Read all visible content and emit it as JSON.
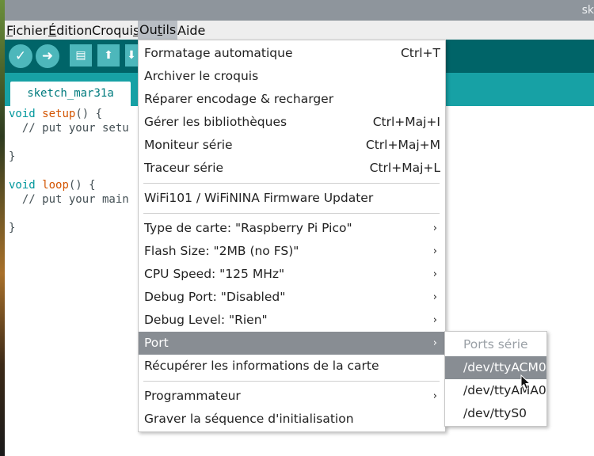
{
  "window": {
    "title": "sk"
  },
  "menubar": {
    "items": [
      {
        "label": "Fichier",
        "underline": "F"
      },
      {
        "label": "Édition",
        "underline": "É"
      },
      {
        "label": "Croquis",
        "underline": "s"
      },
      {
        "label": "Outils",
        "underline": "t"
      },
      {
        "label": "Aide",
        "underline": ""
      }
    ]
  },
  "toolbar": {
    "verify_icon": "checkmark-icon",
    "upload_icon": "arrow-right-icon",
    "new_icon": "file-icon",
    "open_icon": "arrow-up-icon",
    "save_icon": "arrow-down-icon"
  },
  "tabs": [
    {
      "label": "sketch_mar31a"
    }
  ],
  "editor": {
    "lines": [
      {
        "kw": "void",
        "fn": "setup",
        "rest": "() {"
      },
      {
        "text": "  // put your setu"
      },
      {
        "text": ""
      },
      {
        "text": "}"
      },
      {
        "text": ""
      },
      {
        "kw": "void",
        "fn": "loop",
        "rest": "() {"
      },
      {
        "text": "  // put your main"
      },
      {
        "text": ""
      },
      {
        "text": "}"
      }
    ]
  },
  "tools_menu": {
    "items": [
      {
        "label": "Formatage automatique",
        "shortcut": "Ctrl+T"
      },
      {
        "label": "Archiver le croquis",
        "shortcut": ""
      },
      {
        "label": "Réparer encodage & recharger",
        "shortcut": ""
      },
      {
        "label": "Gérer les bibliothèques",
        "shortcut": "Ctrl+Maj+I"
      },
      {
        "label": "Moniteur série",
        "shortcut": "Ctrl+Maj+M"
      },
      {
        "label": "Traceur série",
        "shortcut": "Ctrl+Maj+L"
      },
      {
        "label": "WiFi101 / WiFiNINA Firmware Updater",
        "shortcut": ""
      },
      {
        "label": "Type de carte: \"Raspberry Pi Pico\"",
        "arrow": "›"
      },
      {
        "label": "Flash Size: \"2MB (no FS)\"",
        "arrow": "›"
      },
      {
        "label": "CPU Speed: \"125 MHz\"",
        "arrow": "›"
      },
      {
        "label": "Debug Port: \"Disabled\"",
        "arrow": "›"
      },
      {
        "label": "Debug Level: \"Rien\"",
        "arrow": "›"
      },
      {
        "label": "Port",
        "arrow": "›"
      },
      {
        "label": "Récupérer les informations de la carte"
      },
      {
        "label": "Programmateur",
        "arrow": "›"
      },
      {
        "label": "Graver la séquence d'initialisation"
      }
    ]
  },
  "port_submenu": {
    "header": "Ports série",
    "items": [
      "/dev/ttyACM0",
      "/dev/ttyAMA0",
      "/dev/ttyS0"
    ],
    "selected": "/dev/ttyACM0"
  },
  "colors": {
    "toolbar": "#006468",
    "tabstrip": "#17a1a5",
    "button": "#4db7bb",
    "highlight": "#888d93",
    "keyword": "#00979c",
    "function": "#d35400"
  }
}
